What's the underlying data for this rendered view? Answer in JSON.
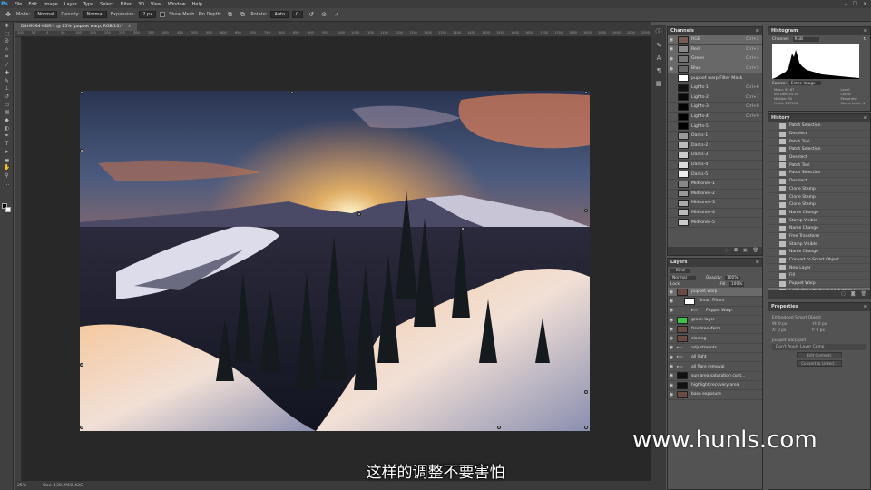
{
  "app": {
    "logo": "Ps"
  },
  "menu": [
    "File",
    "Edit",
    "Image",
    "Layer",
    "Type",
    "Select",
    "Filter",
    "3D",
    "View",
    "Window",
    "Help"
  ],
  "window_controls": [
    "–",
    "☐",
    "✕"
  ],
  "options": {
    "mode_label": "Mode:",
    "mode_value": "Normal",
    "density_label": "Density:",
    "density_value": "Normal",
    "expansion_label": "Expansion:",
    "expansion_value": "2 px",
    "show_mesh": "Show Mesh",
    "pin_depth": "Pin Depth:",
    "rotate_label": "Rotate:",
    "rotate_value": "Auto",
    "rotate_deg": "0"
  },
  "document_tab": {
    "title": "D4H9594-HDR-1 @ 25% (puppet warp, RGB/16) *",
    "close": "×"
  },
  "ruler_ticks": [
    "100",
    "50",
    "0",
    "50",
    "100",
    "150",
    "200",
    "250",
    "300",
    "350",
    "400",
    "450",
    "500",
    "550",
    "600",
    "650",
    "700",
    "750",
    "800",
    "850",
    "900",
    "950",
    "1000",
    "1050",
    "1100",
    "1150",
    "1200",
    "1250",
    "1300",
    "1350",
    "1400",
    "1450",
    "1500",
    "1550",
    "1600",
    "1650",
    "1700",
    "1750",
    "1800",
    "1850",
    "1900",
    "1950",
    "2000",
    "2050"
  ],
  "status": {
    "zoom": "25%",
    "doc": "Doc: 138.2M/2.42G"
  },
  "subtitle": "这样的调整不要害怕",
  "watermark": "www.hunls.com",
  "channels": {
    "title": "Channels",
    "rows": [
      {
        "name": "RGB",
        "shortcut": "Ctrl+2",
        "thumb": "#7a5a55",
        "sel": true
      },
      {
        "name": "Red",
        "shortcut": "Ctrl+3",
        "thumb": "#8a8a8a",
        "sel": true
      },
      {
        "name": "Green",
        "shortcut": "Ctrl+4",
        "thumb": "#777",
        "sel": true
      },
      {
        "name": "Blue",
        "shortcut": "Ctrl+5",
        "thumb": "#666",
        "sel": true
      },
      {
        "name": "puppet warp Filter Mask",
        "shortcut": "",
        "thumb": "#fff",
        "sel": false
      },
      {
        "name": "Lights-1",
        "shortcut": "Ctrl+6",
        "thumb": "#111",
        "sel": false
      },
      {
        "name": "Lights-2",
        "shortcut": "Ctrl+7",
        "thumb": "#0a0a0a",
        "sel": false
      },
      {
        "name": "Lights-3",
        "shortcut": "Ctrl+8",
        "thumb": "#050505",
        "sel": false
      },
      {
        "name": "Lights-4",
        "shortcut": "Ctrl+9",
        "thumb": "#030303",
        "sel": false
      },
      {
        "name": "Lights-5",
        "shortcut": "",
        "thumb": "#000",
        "sel": false
      },
      {
        "name": "Darks-1",
        "shortcut": "",
        "thumb": "#999",
        "sel": false
      },
      {
        "name": "Darks-2",
        "shortcut": "",
        "thumb": "#bbb",
        "sel": false
      },
      {
        "name": "Darks-3",
        "shortcut": "",
        "thumb": "#ccc",
        "sel": false
      },
      {
        "name": "Darks-4",
        "shortcut": "",
        "thumb": "#ddd",
        "sel": false
      },
      {
        "name": "Darks-5",
        "shortcut": "",
        "thumb": "#eee",
        "sel": false
      },
      {
        "name": "Midtones-1",
        "shortcut": "",
        "thumb": "#888",
        "sel": false
      },
      {
        "name": "Midtones-2",
        "shortcut": "",
        "thumb": "#999",
        "sel": false
      },
      {
        "name": "Midtones-3",
        "shortcut": "",
        "thumb": "#aaa",
        "sel": false
      },
      {
        "name": "Midtones-4",
        "shortcut": "",
        "thumb": "#bbb",
        "sel": false
      },
      {
        "name": "Midtones-5",
        "shortcut": "",
        "thumb": "#ccc",
        "sel": false
      }
    ]
  },
  "layers": {
    "title": "Layers",
    "kind": "Kind",
    "blend": "Normal",
    "opacity_label": "Opacity:",
    "opacity_value": "100%",
    "lock_label": "Lock:",
    "fill_label": "Fill:",
    "fill_value": "100%",
    "rows": [
      {
        "name": "puppet warp",
        "thumb": "#6a4a45",
        "sel": true,
        "indent": 0
      },
      {
        "name": "Smart Filters",
        "thumb": "#fff",
        "sel": false,
        "indent": 1
      },
      {
        "name": "Puppet Warp",
        "thumb": "",
        "sel": false,
        "indent": 2
      },
      {
        "name": "green layer",
        "thumb": "#3ec24a",
        "sel": false,
        "indent": 0
      },
      {
        "name": "free transform",
        "thumb": "#6a4a45",
        "sel": false,
        "indent": 0
      },
      {
        "name": "cloning",
        "thumb": "#6a4a45",
        "sel": false,
        "indent": 0
      },
      {
        "name": "adjustments",
        "thumb": "",
        "sel": false,
        "indent": 0
      },
      {
        "name": "all light",
        "thumb": "",
        "sel": false,
        "indent": 0
      },
      {
        "name": "all flare removal",
        "thumb": "",
        "sel": false,
        "indent": 0
      },
      {
        "name": "sun area saturation cont...",
        "thumb": "#111",
        "sel": false,
        "indent": 0
      },
      {
        "name": "highlight recovery area",
        "thumb": "#111",
        "sel": false,
        "indent": 0
      },
      {
        "name": "base exposure",
        "thumb": "#6a4a45",
        "sel": false,
        "indent": 0
      }
    ]
  },
  "histogram": {
    "title": "Histogram",
    "channel_label": "Channel:",
    "channel_value": "RGB",
    "source_label": "Source:",
    "source_value": "Entire Image",
    "stats_left": [
      "Mean: 92.87",
      "Std Dev: 54.78",
      "Median: 85",
      "Pixels: 247556"
    ],
    "stats_right": [
      "Level:",
      "Count:",
      "Percentile:",
      "Cache Level: 4"
    ]
  },
  "history": {
    "title": "History",
    "rows": [
      "Patch Selection",
      "Deselect",
      "Patch Tool",
      "Patch Selection",
      "Deselect",
      "Patch Tool",
      "Patch Selection",
      "Deselect",
      "Clone Stamp",
      "Clone Stamp",
      "Clone Stamp",
      "Name Change",
      "Stamp Visible",
      "Name Change",
      "Free Transform",
      "Stamp Visible",
      "Name Change",
      "Convert to Smart Object",
      "New Layer",
      "Fill",
      "Puppet Warp",
      "Edit Filter Effect ( Puppet Warp )"
    ]
  },
  "properties": {
    "title": "Properties",
    "type": "Embedded Smart Object",
    "w": "W: 0 px",
    "h": "H: 0 px",
    "x": "X: 0 px",
    "y": "Y: 0 px",
    "comps": "puppet warp.psd",
    "comp_value": "Don't Apply Layer Comp",
    "edit_btn": "Edit Contents",
    "convert_btn": "Convert to Linked..."
  }
}
